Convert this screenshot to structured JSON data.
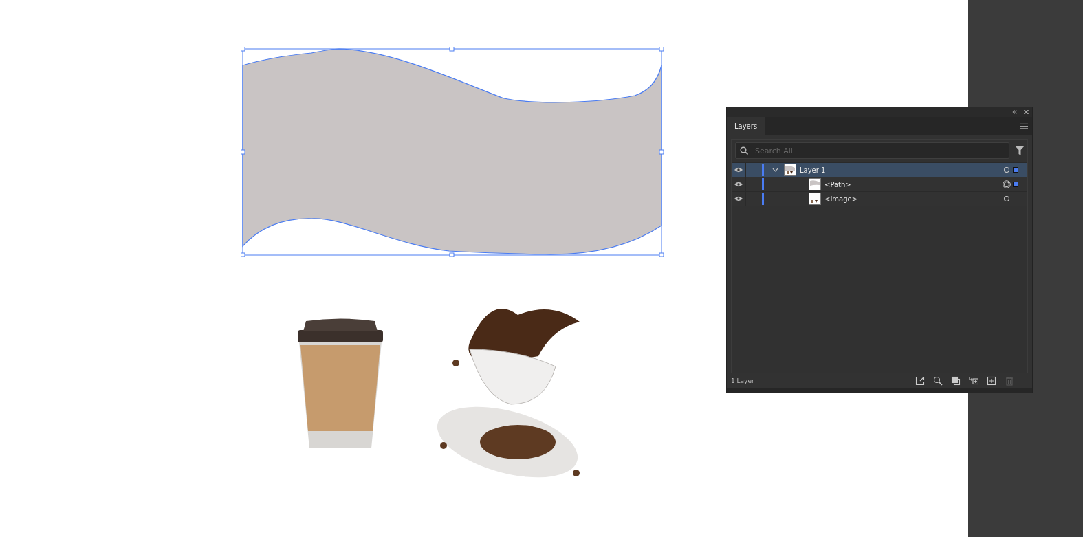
{
  "panel": {
    "tab": "Layers",
    "search": {
      "placeholder": "Search All"
    },
    "layers": [
      {
        "name": "Layer 1",
        "kind": "layer",
        "visible": true,
        "expanded": true,
        "selected": true,
        "targeted": false,
        "has_selection": true,
        "children": [
          {
            "name": "<Path>",
            "kind": "path",
            "visible": true,
            "selected": false,
            "targeted": true,
            "has_selection": true
          },
          {
            "name": "<Image>",
            "kind": "image",
            "visible": true,
            "selected": false,
            "targeted": false,
            "has_selection": false
          }
        ]
      }
    ],
    "status": "1 Layer",
    "footer_buttons": [
      {
        "kind": "export",
        "disabled": false
      },
      {
        "kind": "locate",
        "disabled": false
      },
      {
        "kind": "mask",
        "disabled": false
      },
      {
        "kind": "sublayer",
        "disabled": false
      },
      {
        "kind": "new",
        "disabled": false
      },
      {
        "kind": "delete",
        "disabled": true
      }
    ]
  }
}
